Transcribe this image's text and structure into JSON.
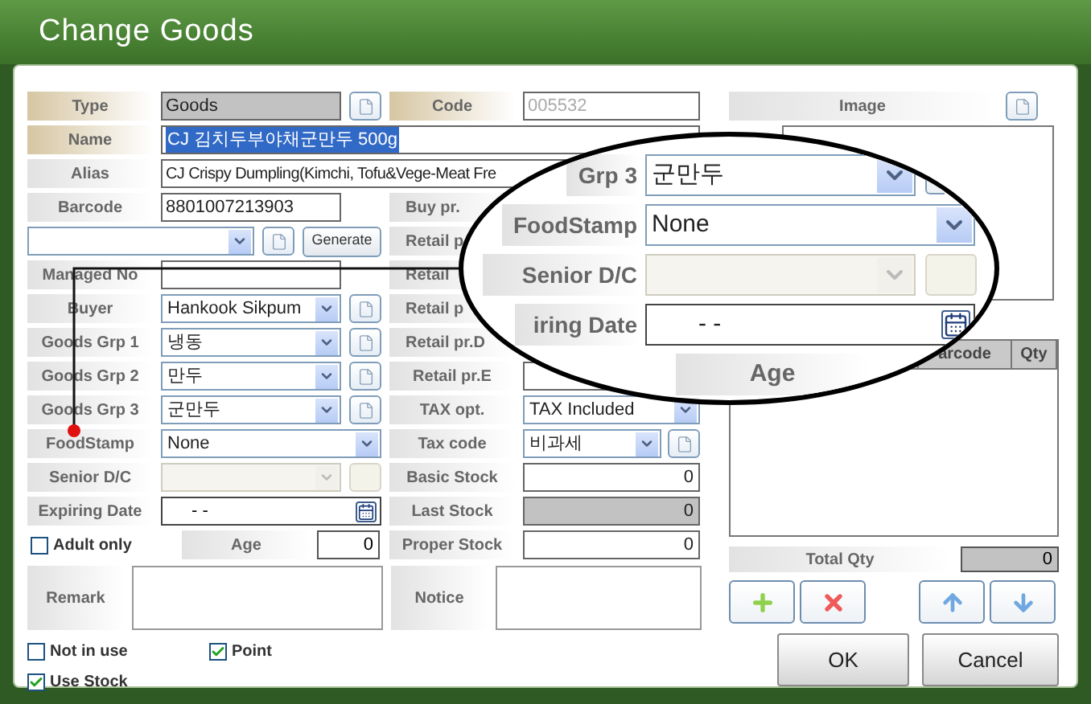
{
  "window": {
    "title": "Change Goods"
  },
  "left_rows": [
    {
      "kind": "text",
      "label": "Type",
      "value": "Goods",
      "required": true,
      "gray": true,
      "file_button": true
    },
    {
      "kind": "text",
      "label": "Name",
      "value": "CJ 김치두부야채군만두 500g",
      "required": true,
      "highlighted": true,
      "wide": true
    },
    {
      "kind": "text",
      "label": "Alias",
      "value": "CJ Crispy Dumpling(Kimchi, Tofu&Vege-Meat Fre",
      "wide": true
    },
    {
      "kind": "text",
      "label": "Barcode",
      "value": "8801007213903"
    },
    {
      "kind": "generate",
      "button": "Generate"
    },
    {
      "kind": "text",
      "label": "Managed No"
    },
    {
      "kind": "select",
      "label": "Buyer",
      "value": "Hankook Sikpum",
      "file_button": true
    },
    {
      "kind": "select",
      "label": "Goods Grp 1",
      "value": "냉동",
      "file_button": true
    },
    {
      "kind": "select",
      "label": "Goods Grp 2",
      "value": "만두",
      "file_button": true
    },
    {
      "kind": "select",
      "label": "Goods Grp 3",
      "value": "군만두",
      "file_button": true
    },
    {
      "kind": "select",
      "label": "FoodStamp",
      "value": "None"
    },
    {
      "kind": "select",
      "label": "Senior D/C",
      "disabled": true,
      "file_button": true
    },
    {
      "kind": "date",
      "label": "Expiring Date",
      "value": "- -"
    },
    {
      "kind": "adult",
      "label": "Adult only",
      "checked": false,
      "age_label": "Age",
      "age_value": "0"
    }
  ],
  "remark": {
    "label": "Remark"
  },
  "middle_rows": [
    {
      "kind": "text",
      "label": "Code",
      "value": "005532",
      "required": true,
      "muted": true
    },
    {
      "label": "Buy pr."
    },
    {
      "label": "Retail p"
    },
    {
      "label": "Retail"
    },
    {
      "label": "Retail p"
    },
    {
      "label": "Retail pr.D"
    },
    {
      "kind": "text",
      "label": "Retail pr.E"
    },
    {
      "kind": "select",
      "label": "TAX opt.",
      "value": "TAX Included"
    },
    {
      "kind": "select",
      "label": "Tax code",
      "value": "비과세",
      "file_button": true
    },
    {
      "kind": "number",
      "label": "Basic Stock",
      "value": "0"
    },
    {
      "kind": "number",
      "label": "Last Stock",
      "value": "0",
      "gray": true
    },
    {
      "kind": "number",
      "label": "Proper Stock",
      "value": "0"
    }
  ],
  "notice": {
    "label": "Notice"
  },
  "options": [
    {
      "label": "Not in use",
      "checked": false
    },
    {
      "label": "Point",
      "checked": true
    },
    {
      "label": "Use Stock",
      "checked": true
    }
  ],
  "image": {
    "label": "Image"
  },
  "barcode_table": {
    "columns": [
      "arcode",
      "Qty"
    ]
  },
  "total": {
    "label": "Total Qty",
    "value": "0"
  },
  "list_buttons": [
    {
      "kind": "add"
    },
    {
      "kind": "delete"
    },
    {
      "kind": "up"
    },
    {
      "kind": "down"
    }
  ],
  "buttons": [
    "OK",
    "Cancel"
  ],
  "magnifier": {
    "rows": [
      {
        "kind": "select",
        "label": "Grp 3",
        "value": "군만두",
        "file_button": true
      },
      {
        "kind": "select",
        "label": "FoodStamp",
        "value": "None"
      },
      {
        "kind": "select",
        "label": "Senior D/C",
        "disabled": true,
        "file_button": true
      },
      {
        "kind": "date",
        "label": "iring Date",
        "value": "- -"
      },
      {
        "kind": "age",
        "label": "Age"
      }
    ]
  }
}
